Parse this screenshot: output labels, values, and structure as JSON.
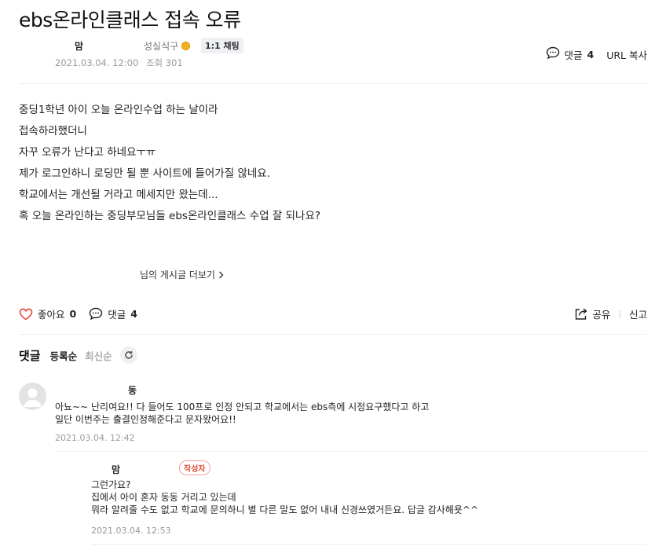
{
  "post": {
    "title": "ebs온라인클래스 접속 오류",
    "author": "맘",
    "level": "성실식구",
    "chat_badge": "1:1 채팅",
    "date": "2021.03.04. 12:00",
    "views": "조회 301",
    "comment_label": "댓글",
    "comment_count": "4",
    "url_copy": "URL 복사",
    "body": [
      "중딩1학년 아이 오늘 온라인수업 하는 날이라",
      "접속하라했더니",
      "자꾸 오류가 난다고 하네요ㅜㅠ",
      "제가 로그인하니 로딩만 될 뿐 사이트에 들어가질 않네요.",
      "학교에서는 개선될 거라고 메세지만 왔는데...",
      "혹 오늘 온라인하는 중딩부모님들 ebs온라인클래스 수업 잘 되나요?"
    ],
    "more_posts": "님의 게시글 더보기"
  },
  "actions": {
    "like_label": "좋아요",
    "like_count": "0",
    "comment_label": "댓글",
    "comment_count": "4",
    "share": "공유",
    "report": "신고"
  },
  "comments_section": {
    "title": "댓글",
    "sort_registered": "등록순",
    "sort_latest": "최신순"
  },
  "comments": [
    {
      "author": "동",
      "lines": [
        "아뇨~~ 난리여요!! 다 들어도 100프로 인정 안되고 학교에서는 ebs측에 시정요구했다고 하고",
        "일단 이번주는 출결인정해준다고 문자왔어요!!"
      ],
      "date": "2021.03.04. 12:42"
    },
    {
      "author": "맘",
      "badge": "작성자",
      "lines": [
        "그런가요?",
        "집에서 아이 혼자 동동 거리고 있는데",
        "뭐라 알려줄 수도 없고 학교에 문의하니 별 다른 말도 없어 내내 신경쓰였거든요. 답글 감사해욧^^"
      ],
      "date": "2021.03.04. 12:53"
    }
  ]
}
